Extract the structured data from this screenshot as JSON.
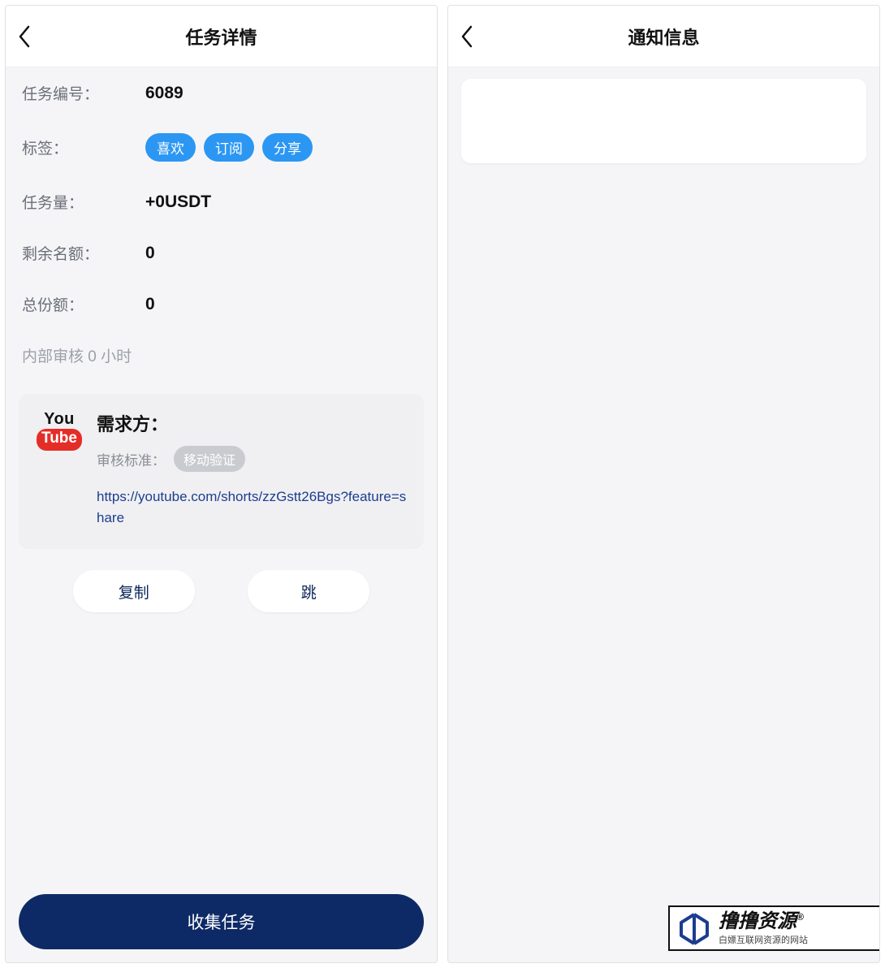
{
  "leftPanel": {
    "title": "任务详情",
    "rows": {
      "task_no_label": "任务编号：",
      "task_no_value": "6089",
      "tags_label": "标签：",
      "tags": [
        "喜欢",
        "订阅",
        "分享"
      ],
      "amount_label": "任务量：",
      "amount_value": "+0USDT",
      "remaining_label": "剩余名额：",
      "remaining_value": "0",
      "total_label": "总份额：",
      "total_value": "0"
    },
    "review_note": "内部审核 0 小时",
    "card": {
      "logo": {
        "you": "You",
        "tube": "Tube"
      },
      "title": "需求方：",
      "meta_label": "审核标准：",
      "meta_pill": "移动验证",
      "link": "https://youtube.com/shorts/zzGstt26Bgs?feature=share"
    },
    "actions": {
      "copy": "复制",
      "jump": "跳"
    },
    "primary": "收集任务"
  },
  "rightPanel": {
    "title": "通知信息"
  },
  "watermark": {
    "main": "撸撸资源",
    "reg": "®",
    "sub": "白嫖互联网资源的网站"
  }
}
